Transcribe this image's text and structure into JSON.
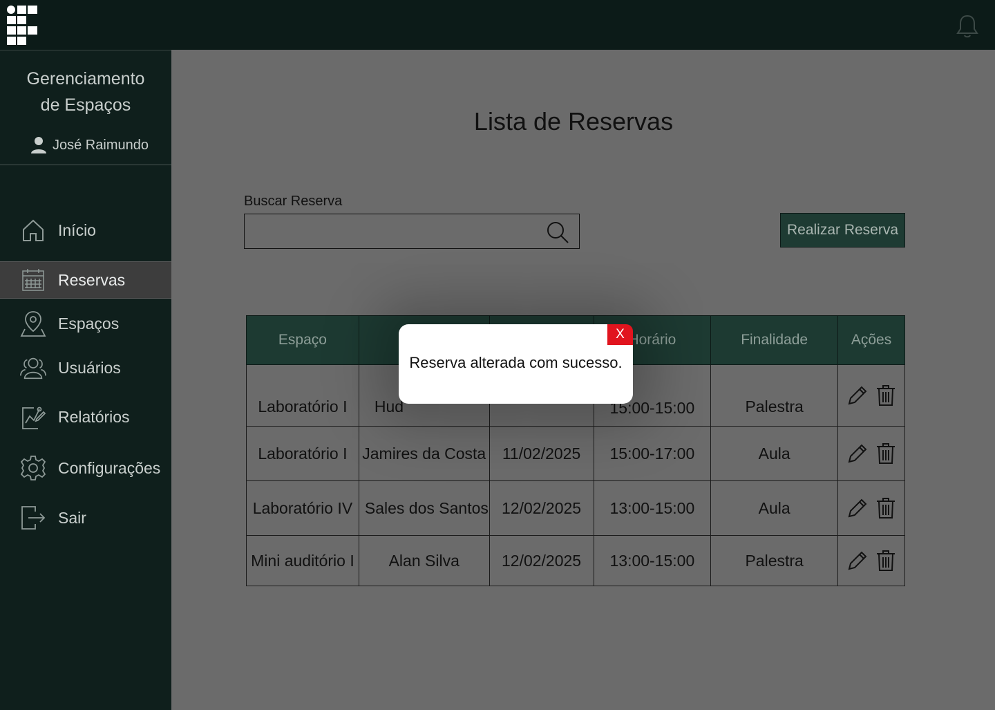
{
  "sidebar": {
    "title_line1": "Gerenciamento",
    "title_line2": "de Espaços",
    "user_name": "José Raimundo",
    "items": [
      {
        "label": "Início",
        "icon": "home-icon"
      },
      {
        "label": "Reservas",
        "icon": "calendar-icon",
        "active": true
      },
      {
        "label": "Espaços",
        "icon": "location-pin-icon"
      },
      {
        "label": "Usuários",
        "icon": "users-icon"
      },
      {
        "label": "Relatórios",
        "icon": "report-chart-icon"
      },
      {
        "label": "Configurações",
        "icon": "gear-icon"
      },
      {
        "label": "Sair",
        "icon": "logout-icon"
      }
    ]
  },
  "header": {
    "notification_icon": "bell-icon"
  },
  "main": {
    "title": "Lista de Reservas",
    "search": {
      "label": "Buscar Reserva",
      "value": "",
      "placeholder": ""
    },
    "new_reservation_button": "Realizar Reserva"
  },
  "table": {
    "headers": [
      "Espaço",
      "",
      "",
      "Horário",
      "Finalidade",
      "Ações"
    ],
    "rows": [
      {
        "espaco": "Laboratório I",
        "usuario": "Hud",
        "data": "",
        "horario": "15:00-15:00",
        "finalidade": "Palestra"
      },
      {
        "espaco": "Laboratório I",
        "usuario": "Jamires da Costa",
        "data": "11/02/2025",
        "horario": "15:00-17:00",
        "finalidade": "Aula"
      },
      {
        "espaco": "Laboratório IV",
        "usuario": "Sales dos Santos",
        "data": "12/02/2025",
        "horario": "13:00-15:00",
        "finalidade": "Aula"
      },
      {
        "espaco": "Mini auditório I",
        "usuario": "Alan Silva",
        "data": "12/02/2025",
        "horario": "13:00-15:00",
        "finalidade": "Palestra"
      }
    ]
  },
  "modal": {
    "message": "Reserva alterada com sucesso.",
    "close_label": "X",
    "close_color": "#e1141e"
  },
  "colors": {
    "topbar": "#0c1b18",
    "sidebar": "#0f1f1c",
    "overlay_bg": "#6b6b6b",
    "table_header": "#1d3a32",
    "primary_button": "#1e3b33"
  }
}
